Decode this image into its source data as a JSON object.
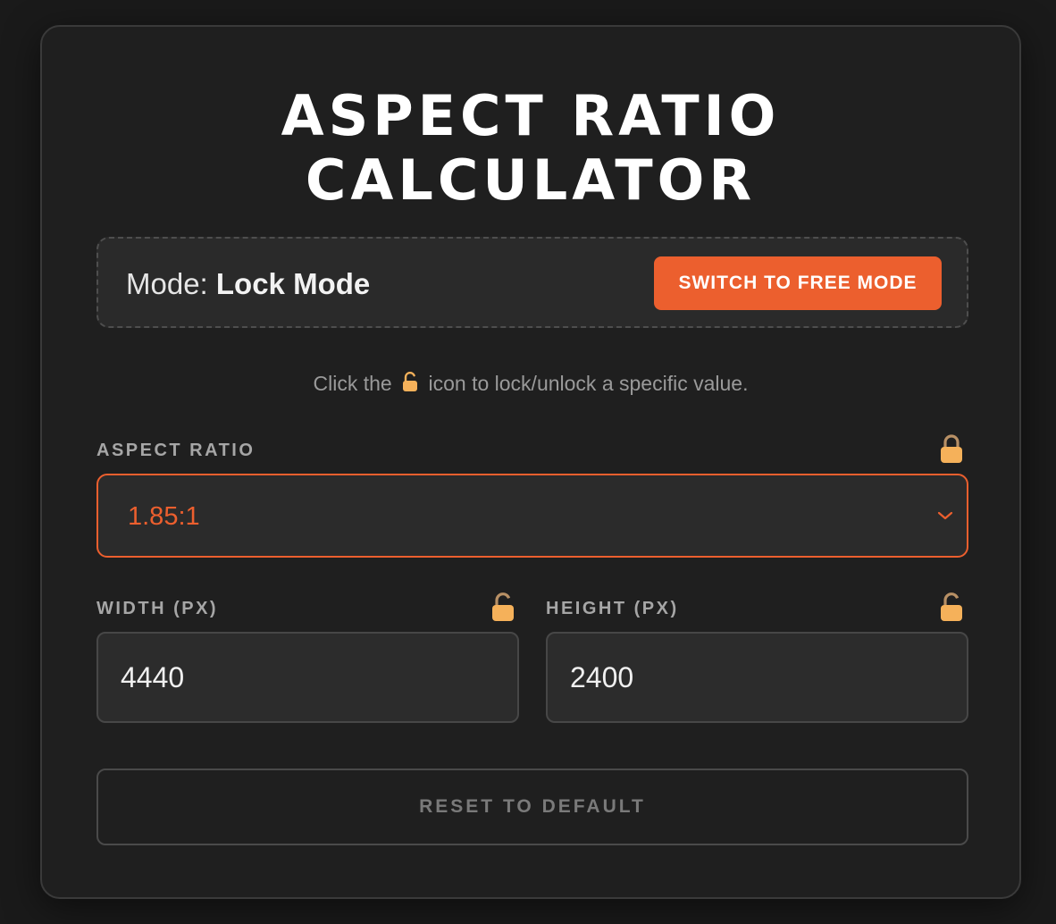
{
  "header": {
    "title_line1": "ASPECT RATIO",
    "title_line2": "CALCULATOR"
  },
  "mode": {
    "prefix": "Mode:",
    "current": "Lock Mode",
    "switch_label": "SWITCH TO FREE MODE"
  },
  "hint": {
    "before": "Click the",
    "icon": "padlock-icon",
    "after": "icon to lock/unlock a specific value."
  },
  "aspect_ratio": {
    "label": "ASPECT RATIO",
    "selected": "1.85:1",
    "lock_state": "locked"
  },
  "width": {
    "label": "WIDTH (PX)",
    "value": "4440",
    "lock_state": "unlocked"
  },
  "height": {
    "label": "HEIGHT (PX)",
    "value": "2400",
    "lock_state": "unlocked"
  },
  "reset_label": "RESET TO DEFAULT",
  "colors": {
    "accent": "#ec5f2e",
    "lock": "#f5b15a",
    "background": "#1a1a1a",
    "card": "#1f1f1f"
  }
}
